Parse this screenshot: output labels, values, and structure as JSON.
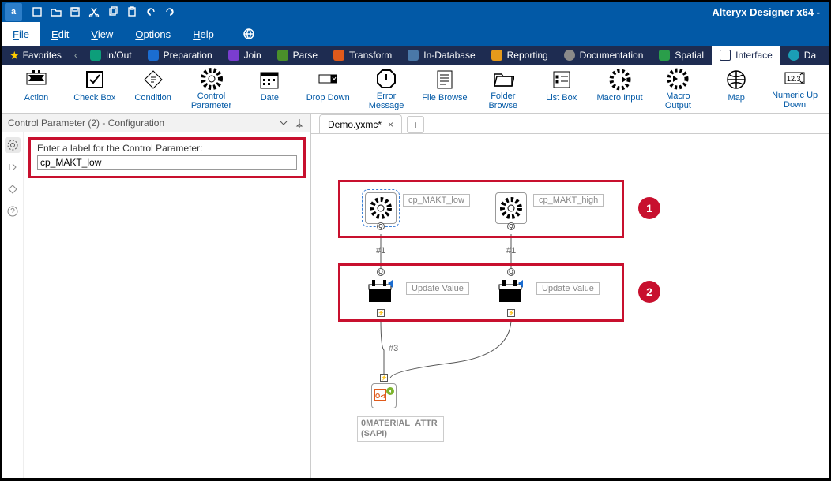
{
  "window_title": "Alteryx Designer x64 -",
  "menu": {
    "file": "File",
    "edit": "Edit",
    "view": "View",
    "options": "Options",
    "help": "Help"
  },
  "categories": {
    "favorites": "Favorites",
    "inout": "In/Out",
    "prep": "Preparation",
    "join": "Join",
    "parse": "Parse",
    "transform": "Transform",
    "indb": "In-Database",
    "reporting": "Reporting",
    "documentation": "Documentation",
    "spatial": "Spatial",
    "interface": "Interface",
    "da": "Da"
  },
  "tools": [
    {
      "label": "Action"
    },
    {
      "label": "Check Box"
    },
    {
      "label": "Condition"
    },
    {
      "label": "Control\nParameter"
    },
    {
      "label": "Date"
    },
    {
      "label": "Drop Down"
    },
    {
      "label": "Error\nMessage"
    },
    {
      "label": "File Browse"
    },
    {
      "label": "Folder\nBrowse"
    },
    {
      "label": "List Box"
    },
    {
      "label": "Macro Input"
    },
    {
      "label": "Macro\nOutput"
    },
    {
      "label": "Map"
    },
    {
      "label": "Numeric Up\nDown"
    }
  ],
  "config": {
    "panel_title": "Control Parameter (2) - Configuration",
    "field_label": "Enter a label for the Control Parameter:",
    "field_value": "cp_MAKT_low"
  },
  "doc": {
    "tab": "Demo.yxmc*"
  },
  "nodes": {
    "cp1": "cp_MAKT_low",
    "cp2": "cp_MAKT_high",
    "uv1": "Update Value",
    "uv2": "Update Value",
    "conn1": "#1",
    "conn2": "#1",
    "conn3": "#3",
    "bottom": "0MATERIAL_ATTR (SAPI)"
  },
  "callouts": {
    "one": "1",
    "two": "2"
  }
}
